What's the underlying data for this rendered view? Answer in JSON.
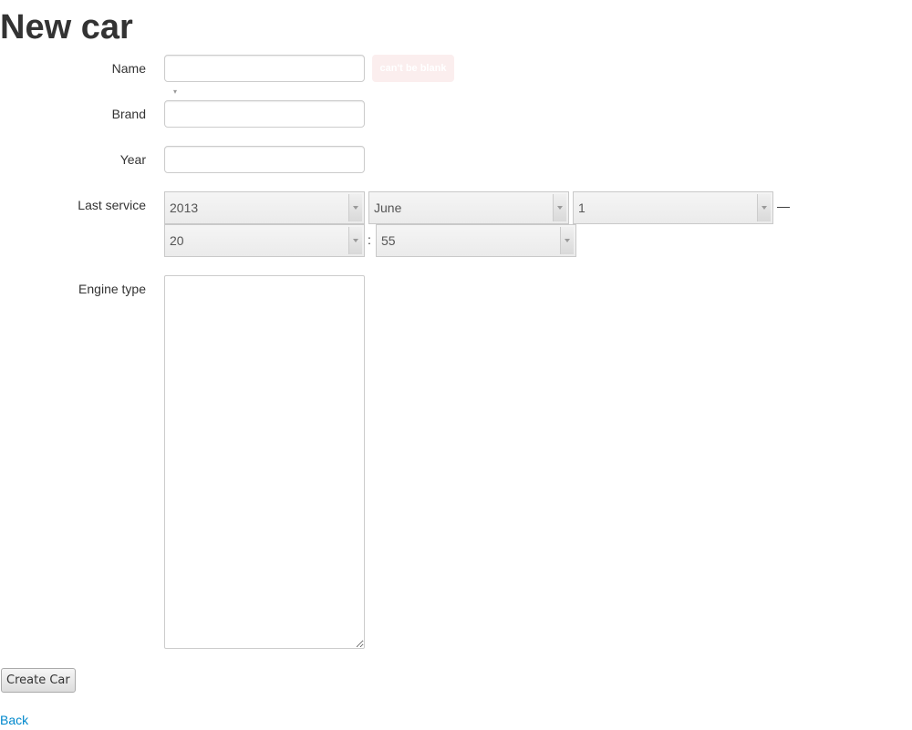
{
  "page": {
    "title": "New car"
  },
  "form": {
    "name": {
      "label": "Name",
      "value": "",
      "error": "can't be blank"
    },
    "brand": {
      "label": "Brand",
      "value": ""
    },
    "year": {
      "label": "Year",
      "value": ""
    },
    "last_service": {
      "label": "Last service",
      "year": "2013",
      "month": "June",
      "day": "1",
      "date_time_separator": "—",
      "hour": "20",
      "time_separator": ":",
      "minute": "55"
    },
    "engine_type": {
      "label": "Engine type",
      "value": ""
    },
    "submit_label": "Create Car"
  },
  "links": {
    "back": "Back"
  }
}
